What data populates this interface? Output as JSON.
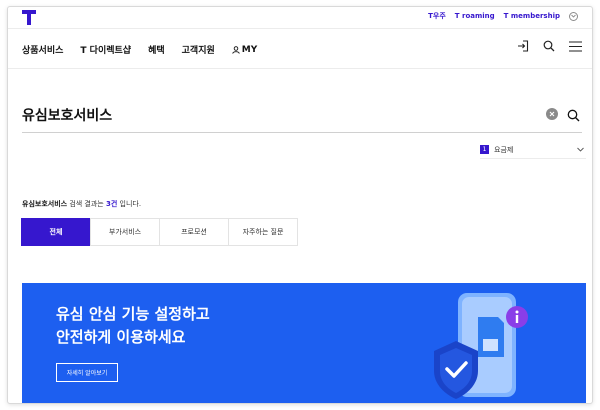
{
  "utility": {
    "links": [
      "T우주",
      "T roaming",
      "T membership"
    ]
  },
  "nav": {
    "items": [
      "상품서비스",
      "T 다이렉트샵",
      "혜택",
      "고객지원",
      "MY"
    ]
  },
  "search": {
    "value": "유심보호서비스"
  },
  "category": {
    "badge": "1",
    "label": "요금제"
  },
  "result": {
    "keyword": "유심보호서비스",
    "mid": " 검색 결과는 ",
    "count": "3건",
    "tail": " 입니다."
  },
  "tabs": [
    {
      "label": "전체",
      "active": true
    },
    {
      "label": "부가서비스",
      "active": false
    },
    {
      "label": "프로모션",
      "active": false
    },
    {
      "label": "자주하는 질문",
      "active": false
    }
  ],
  "banner": {
    "line1": "유심 안심 기능 설정하고",
    "line2": "안전하게 이용하세요",
    "button": "자세히 알아보기"
  },
  "colors": {
    "brand": "#3617ce",
    "banner": "#1d5ff0"
  }
}
